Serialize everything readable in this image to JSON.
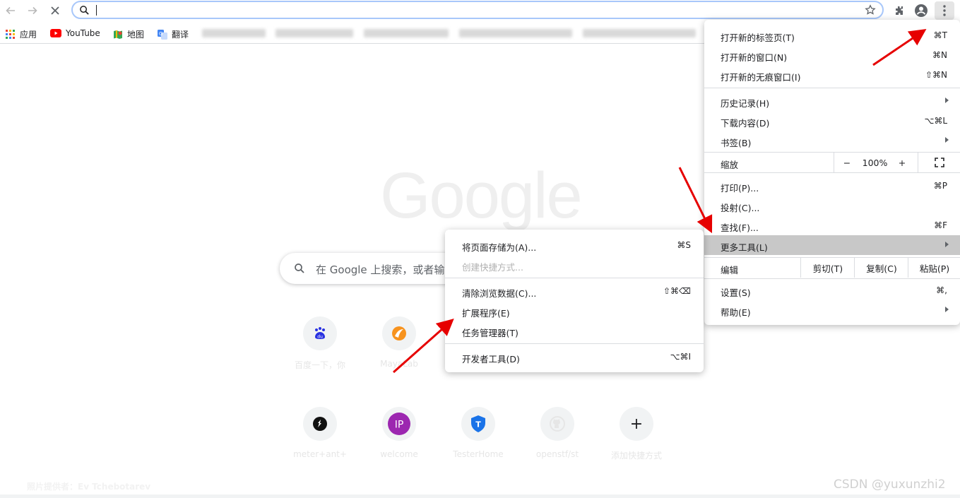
{
  "omnibox": {
    "value": ""
  },
  "bookmarks": [
    {
      "label": "应用",
      "icon": "apps-grid-icon"
    },
    {
      "label": "YouTube",
      "icon": "youtube-icon"
    },
    {
      "label": "地图",
      "icon": "maps-icon"
    },
    {
      "label": "翻译",
      "icon": "translate-icon"
    }
  ],
  "ntp": {
    "logo": "Google",
    "search_placeholder": "在 Google 上搜索，或者输入网址",
    "tiles": [
      {
        "label": "百度一下，你",
        "glyph": "du",
        "color": "#2932e1"
      },
      {
        "label": "MayaLab",
        "glyph": "",
        "color": "#f7931e"
      },
      {
        "label": "",
        "glyph": "",
        "color": "#f1f3f4"
      },
      {
        "label": "",
        "glyph": "",
        "color": "#f1f3f4"
      },
      {
        "label": "",
        "glyph": "",
        "color": "#f1f3f4"
      },
      {
        "label": "meter+ant+",
        "glyph": "",
        "color": "#111111"
      },
      {
        "label": "welcome",
        "glyph": "IP",
        "color": "#9c27b0"
      },
      {
        "label": "TesterHome",
        "glyph": "T",
        "color": "#1a73e8"
      },
      {
        "label": "openstf/st",
        "glyph": "",
        "color": "#f1f3f4"
      },
      {
        "label": "添加快捷方式",
        "glyph": "+",
        "color": "#f1f3f4"
      }
    ],
    "credit": "照片提供者：Ev Tchebotarev"
  },
  "watermark": "CSDN @yuxunzhi2",
  "main_menu": {
    "items": [
      {
        "label": "打开新的标签页(T)",
        "shortcut": "⌘T"
      },
      {
        "label": "打开新的窗口(N)",
        "shortcut": "⌘N"
      },
      {
        "label": "打开新的无痕窗口(I)",
        "shortcut": "⇧⌘N"
      },
      {
        "label": "历史记录(H)",
        "shortcut": ""
      },
      {
        "label": "下载内容(D)",
        "shortcut": "⌥⌘L"
      },
      {
        "label": "书签(B)",
        "shortcut": ""
      },
      {
        "label": "打印(P)...",
        "shortcut": "⌘P"
      },
      {
        "label": "投射(C)...",
        "shortcut": ""
      },
      {
        "label": "查找(F)...",
        "shortcut": "⌘F"
      },
      {
        "label": "更多工具(L)",
        "shortcut": ""
      },
      {
        "label": "设置(S)",
        "shortcut": "⌘,"
      },
      {
        "label": "帮助(E)",
        "shortcut": ""
      }
    ],
    "zoom": {
      "label": "缩放",
      "minus": "−",
      "value": "100%",
      "plus": "+"
    },
    "edit": {
      "label": "编辑",
      "cut": "剪切(T)",
      "copy": "复制(C)",
      "paste": "粘贴(P)"
    }
  },
  "sub_menu": {
    "items": [
      {
        "label": "将页面存储为(A)...",
        "shortcut": "⌘S"
      },
      {
        "label": "创建快捷方式...",
        "shortcut": ""
      },
      {
        "label": "清除浏览数据(C)...",
        "shortcut": "⇧⌘⌫"
      },
      {
        "label": "扩展程序(E)",
        "shortcut": ""
      },
      {
        "label": "任务管理器(T)",
        "shortcut": ""
      },
      {
        "label": "开发者工具(D)",
        "shortcut": "⌥⌘I"
      }
    ]
  },
  "colors": {
    "accent": "#1a73e8",
    "arrow": "#e60000",
    "highlight": "#c8c8c8"
  }
}
